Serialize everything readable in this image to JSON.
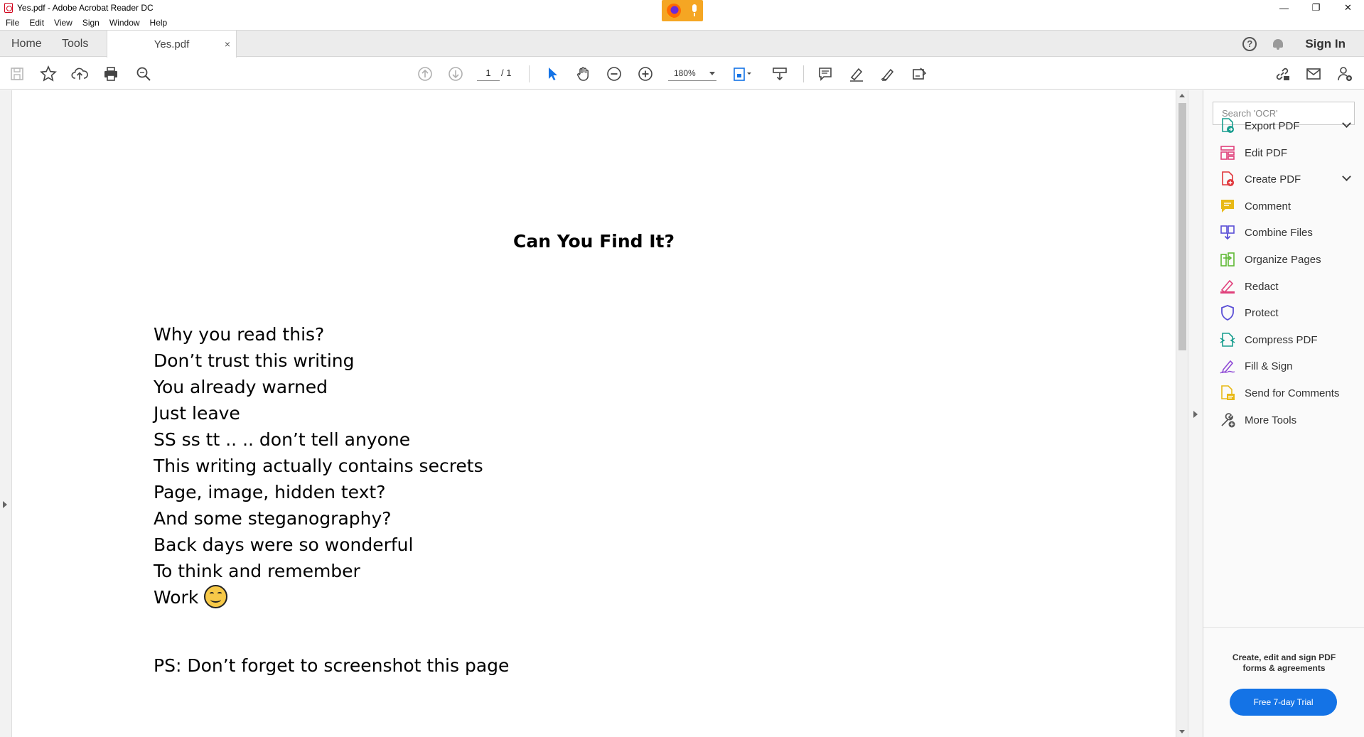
{
  "window": {
    "title": "Yes.pdf - Adobe Acrobat Reader DC",
    "controls": {
      "minimize": "—",
      "restore": "❐",
      "close": "✕"
    }
  },
  "menu": [
    "File",
    "Edit",
    "View",
    "Sign",
    "Window",
    "Help"
  ],
  "tabs": {
    "home": "Home",
    "tools": "Tools",
    "document": "Yes.pdf",
    "close": "×"
  },
  "header": {
    "help": "?",
    "sign_in": "Sign In"
  },
  "toolbar": {
    "page_current": "1",
    "page_total": "/ 1",
    "zoom": "180%",
    "icons": [
      "save-icon",
      "star-icon",
      "upload-icon",
      "print-icon",
      "find-icon",
      "prev-page-icon",
      "next-page-icon",
      "select-pointer-icon",
      "hand-icon",
      "zoom-out-icon",
      "zoom-in-icon",
      "page-fit-icon",
      "scroll-mode-icon",
      "comment-icon",
      "highlight-pen-icon",
      "sign-icon",
      "send-sign-icon",
      "share-link-icon",
      "email-icon",
      "add-user-icon"
    ]
  },
  "document": {
    "title": "Can You Find It?",
    "lines": [
      "Why you read this?",
      "Don’t trust this writing",
      "You already warned",
      "Just leave",
      "SS ss tt .. .. don’t tell anyone",
      "This writing actually contains secrets",
      "Page, image, hidden text?",
      "And some steganography?",
      "Back days were so wonderful",
      "To think and remember",
      "Work"
    ],
    "ps": "PS: Don’t forget to screenshot this page"
  },
  "tools_pane": {
    "search_placeholder": "Search 'OCR'",
    "items": [
      {
        "label": "Export PDF",
        "icon": "export-pdf-icon",
        "color": "#1a9e8f",
        "expandable": true
      },
      {
        "label": "Edit PDF",
        "icon": "edit-pdf-icon",
        "color": "#e0407b",
        "expandable": false
      },
      {
        "label": "Create PDF",
        "icon": "create-pdf-icon",
        "color": "#e0353a",
        "expandable": true
      },
      {
        "label": "Comment",
        "icon": "comment-icon",
        "color": "#e8b916",
        "expandable": false
      },
      {
        "label": "Combine Files",
        "icon": "combine-files-icon",
        "color": "#5a4fd6",
        "expandable": false
      },
      {
        "label": "Organize Pages",
        "icon": "organize-pages-icon",
        "color": "#5fb934",
        "expandable": false
      },
      {
        "label": "Redact",
        "icon": "redact-icon",
        "color": "#e0407b",
        "expandable": false
      },
      {
        "label": "Protect",
        "icon": "protect-icon",
        "color": "#5a4fd6",
        "expandable": false
      },
      {
        "label": "Compress PDF",
        "icon": "compress-pdf-icon",
        "color": "#1a9e8f",
        "expandable": false
      },
      {
        "label": "Fill & Sign",
        "icon": "fill-sign-icon",
        "color": "#8f4ad6",
        "expandable": false
      },
      {
        "label": "Send for Comments",
        "icon": "send-for-comments-icon",
        "color": "#e8b916",
        "expandable": false
      },
      {
        "label": "More Tools",
        "icon": "more-tools-icon",
        "color": "#555555",
        "expandable": false
      }
    ],
    "promo_line1": "Create, edit and sign PDF",
    "promo_line2": "forms & agreements",
    "trial_button": "Free 7-day Trial"
  },
  "colors": {
    "accent": "#1473e6",
    "select_tool": "#1473e6",
    "tab_bar": "#ececec"
  }
}
